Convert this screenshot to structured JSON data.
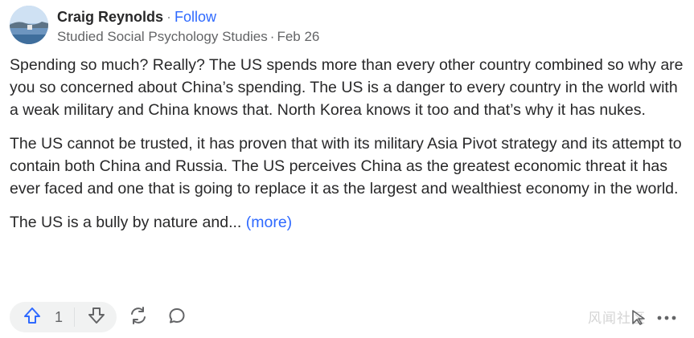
{
  "author": {
    "name": "Craig Reynolds",
    "separator": "·",
    "follow_label": "Follow",
    "credential": "Studied Social Psychology Studies",
    "date": "Feb 26"
  },
  "content": {
    "paragraphs": [
      "Spending so much? Really? The US spends more than every other country combined so why are you so concerned about China’s spending. The US is a danger to every country in the world with a weak military and China knows that. North Korea knows it too and that’s why it has nukes.",
      "The US cannot be trusted, it has proven that with its military Asia Pivot strategy and its attempt to contain both China and Russia. The US perceives China as the greatest economic threat it has ever faced and one that is going to replace it as the largest and wealthiest economy in the world."
    ],
    "truncated_text": "The US is a bully by nature and...",
    "more_label": "(more)"
  },
  "actions": {
    "upvote_count": "1",
    "icons": [
      "upvote-icon",
      "downvote-icon",
      "share-icon",
      "comment-icon",
      "more-icon"
    ]
  },
  "watermark": "风闻社区"
}
